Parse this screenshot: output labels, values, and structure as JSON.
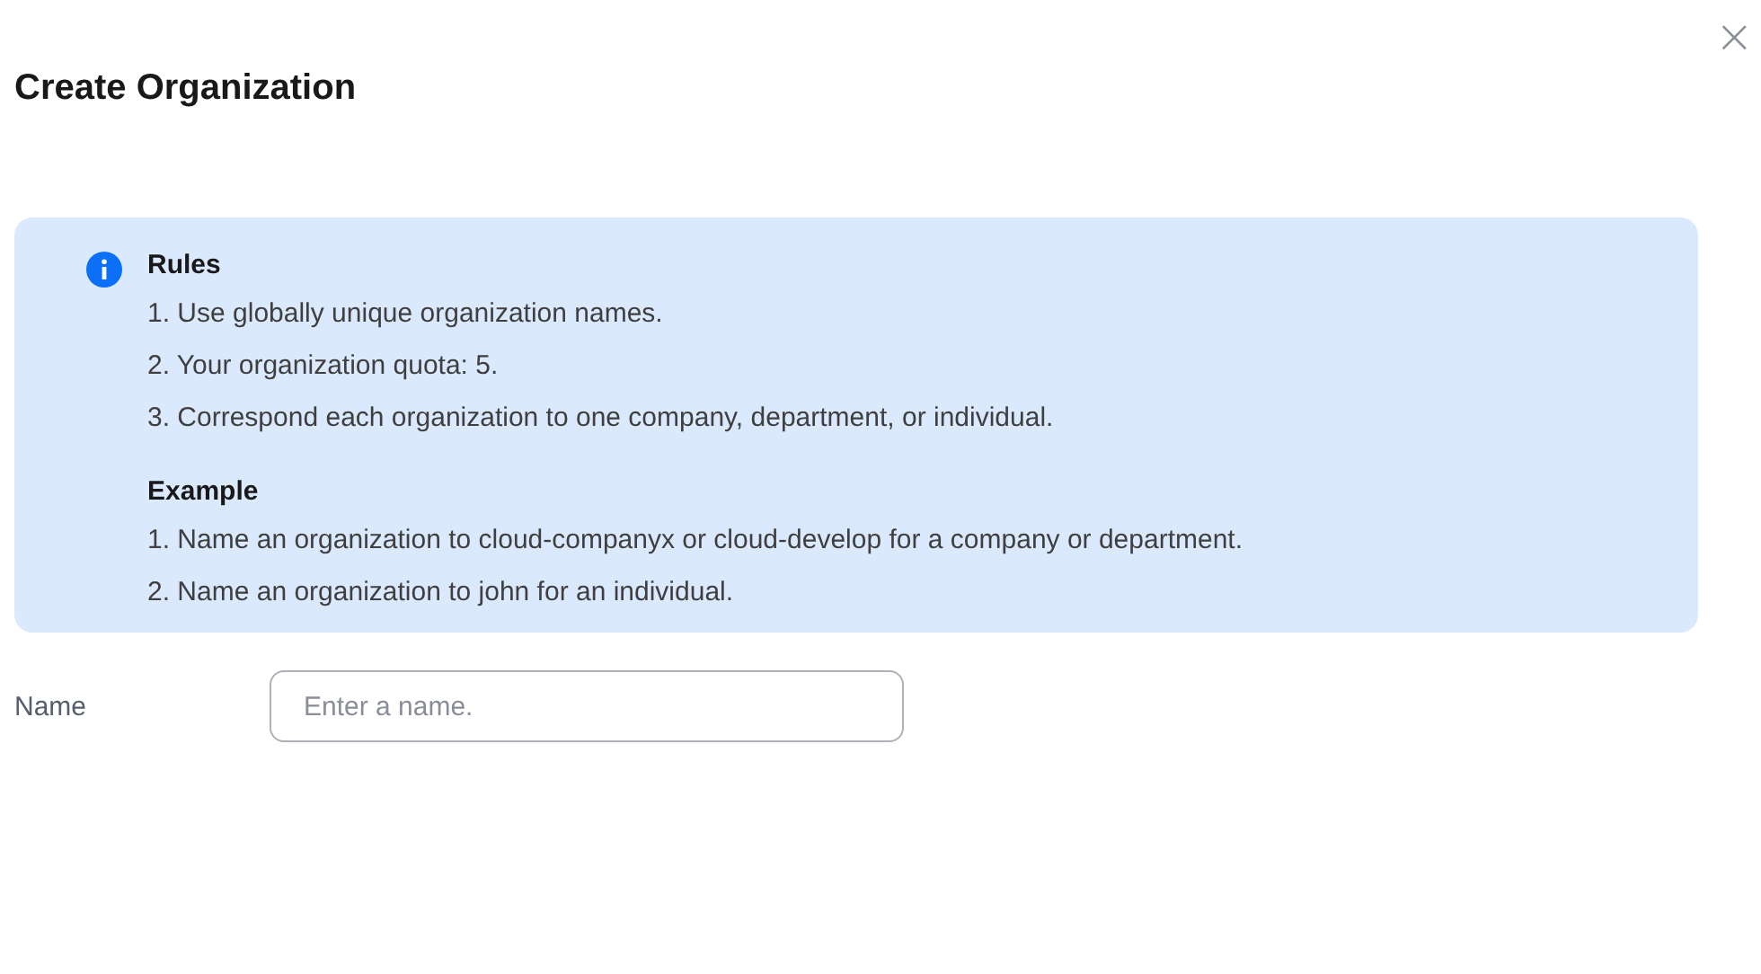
{
  "dialog": {
    "title": "Create Organization",
    "close": "×"
  },
  "notice": {
    "sections": [
      {
        "heading": "Rules",
        "items": [
          "1. Use globally unique organization names.",
          "2. Your organization quota: 5.",
          "3. Correspond each organization to one company, department, or individual."
        ]
      },
      {
        "heading": "Example",
        "items": [
          "1. Name an organization to cloud-companyx or cloud-develop for a company or department.",
          "2. Name an organization to john for an individual."
        ]
      }
    ]
  },
  "form": {
    "fields": [
      {
        "label": "Name",
        "placeholder": "Enter a name."
      }
    ]
  }
}
